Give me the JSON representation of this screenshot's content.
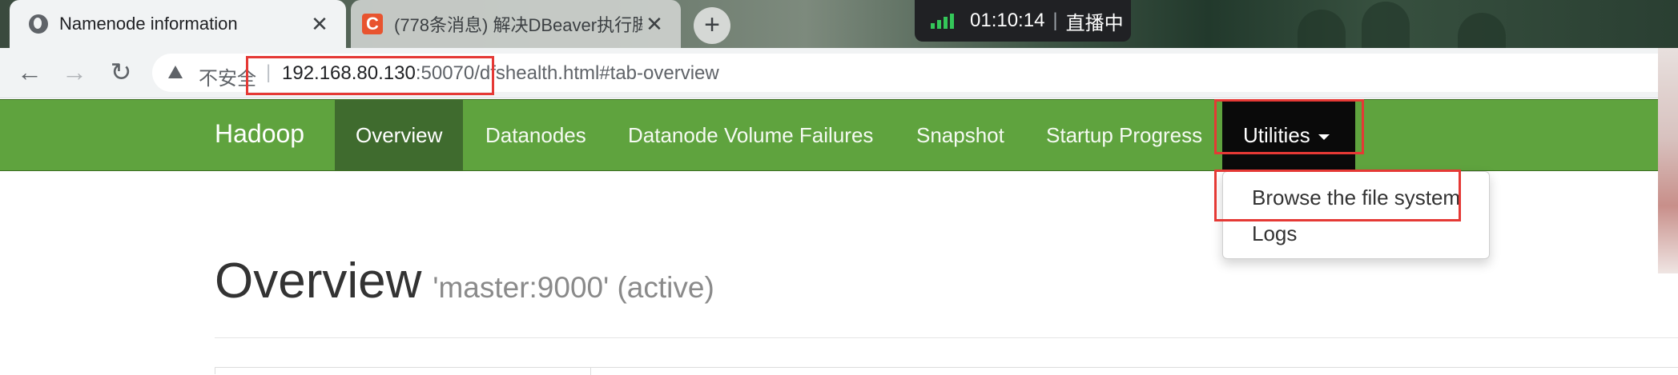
{
  "browser": {
    "tabs": [
      {
        "title": "Namenode information",
        "icon": "globe-icon",
        "close": "✕"
      },
      {
        "title": "(778条消息) 解决DBeaver执行脚",
        "icon": "csdn-c-icon",
        "icon_text": "C",
        "close": "✕"
      }
    ],
    "new_tab": "+",
    "live_badge": {
      "time": "01:10:14",
      "sep": "|",
      "label": "直播中"
    },
    "nav": {
      "back": "←",
      "forward": "→",
      "reload": "↻"
    },
    "address": {
      "security_label": "不安全",
      "separator": "|",
      "host": "192.168.80.130",
      "port": ":50070",
      "path": "/dfshealth.html#tab-overview"
    }
  },
  "navbar": {
    "brand": "Hadoop",
    "items": [
      "Overview",
      "Datanodes",
      "Datanode Volume Failures",
      "Snapshot",
      "Startup Progress",
      "Utilities"
    ],
    "active": "Overview",
    "dropdown": [
      "Browse the file system",
      "Logs"
    ]
  },
  "main": {
    "title": "Overview",
    "subtitle": "'master:9000' (active)"
  },
  "colors": {
    "navbar": "#5fa33e",
    "nav_active": "#3f6b2e",
    "nav_open": "#0a0a0a",
    "highlight": "#e53935"
  }
}
